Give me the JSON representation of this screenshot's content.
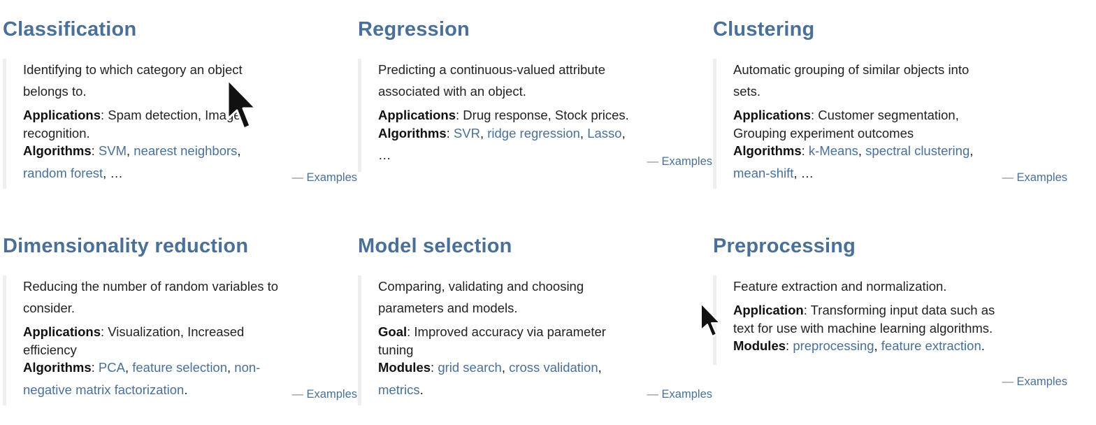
{
  "cards": [
    {
      "title": "Classification",
      "desc1": "Identifying to which category an object",
      "desc2": "belongs to.",
      "app_label": "Applications",
      "app_text1": ": Spam detection, Image",
      "app_text2": "recognition.",
      "alg_label": "Algorithms",
      "links": [
        "SVM",
        "nearest neighbors",
        "random forest"
      ],
      "ellipsis": "…",
      "examples": "Examples"
    },
    {
      "title": "Regression",
      "desc1": "Predicting a continuous-valued attribute",
      "desc2": "associated with an object.",
      "app_label": "Applications",
      "app_text1": ": Drug response, Stock prices.",
      "alg_label": "Algorithms",
      "links": [
        "SVR",
        "ridge regression",
        "Lasso"
      ],
      "ellipsis": "…",
      "examples": "Examples"
    },
    {
      "title": "Clustering",
      "desc1": "Automatic grouping of similar objects into",
      "desc2": "sets.",
      "app_label": "Applications",
      "app_text1": ": Customer segmentation,",
      "app_text2": "Grouping experiment outcomes",
      "alg_label": "Algorithms",
      "links": [
        "k-Means",
        "spectral clustering",
        "mean-shift"
      ],
      "ellipsis": "…",
      "examples": "Examples"
    },
    {
      "title": "Dimensionality reduction",
      "desc1": "Reducing the number of random variables to",
      "desc2": "consider.",
      "app_label": "Applications",
      "app_text1": ": Visualization, Increased",
      "app_text2": "efficiency",
      "alg_label": "Algorithms",
      "links": [
        "PCA",
        "feature selection",
        "non-",
        "negative matrix factorization"
      ],
      "examples": "Examples"
    },
    {
      "title": "Model selection",
      "desc1": "Comparing, validating and choosing",
      "desc2": "parameters and models.",
      "goal_label": "Goal",
      "goal_text1": ": Improved accuracy via parameter",
      "goal_text2": "tuning",
      "mod_label": "Modules",
      "links": [
        "grid search",
        "cross validation",
        "metrics"
      ],
      "examples": "Examples"
    },
    {
      "title": "Preprocessing",
      "desc1": "Feature extraction and normalization.",
      "app_label": "Application",
      "app_text1": ": Transforming input data such as",
      "app_text2": "text for use with machine learning algorithms.",
      "mod_label": "Modules",
      "links": [
        "preprocessing",
        "feature extraction"
      ],
      "examples": "Examples"
    }
  ],
  "punct": {
    "comma": ", ",
    "period": ".",
    "dash": "— "
  }
}
